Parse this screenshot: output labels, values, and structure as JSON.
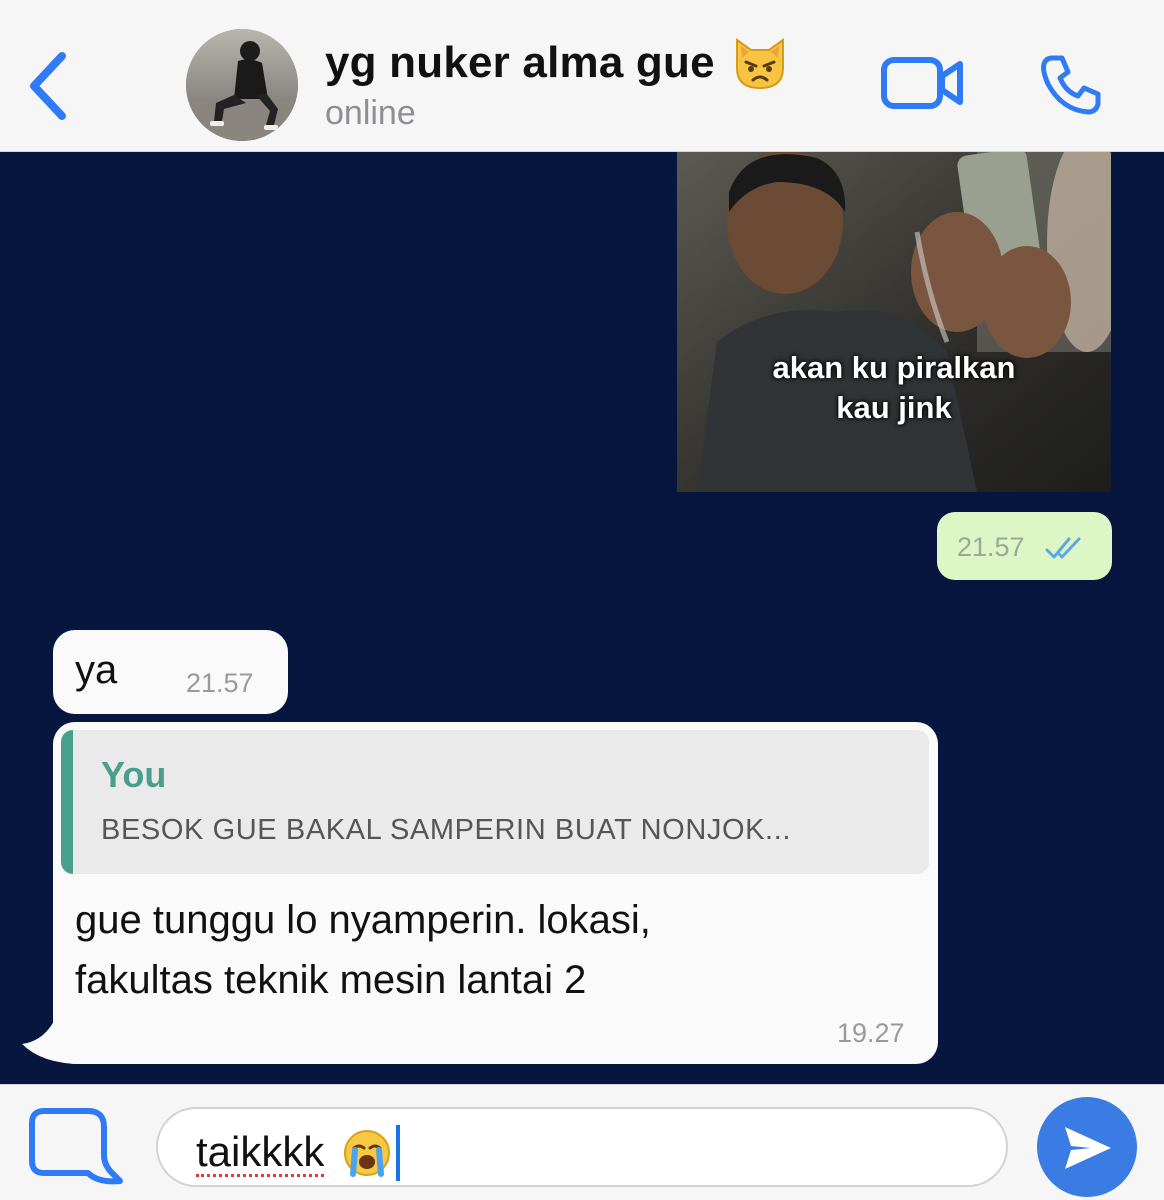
{
  "header": {
    "contact_name": "yg nuker alma gue",
    "status": "online",
    "accent_color": "#2f7bf5",
    "icons": [
      "chevron-left-icon",
      "avatar",
      "pouting-cat-emoji",
      "video-camera-icon",
      "phone-icon"
    ]
  },
  "messages": [
    {
      "direction": "outgoing",
      "type": "image",
      "caption_lines": [
        "akan ku piralkan",
        "kau jink"
      ],
      "time": "21.57",
      "read_receipt": "double-check-icon"
    },
    {
      "direction": "incoming",
      "type": "text",
      "text": "ya",
      "time": "21.57"
    },
    {
      "direction": "incoming",
      "type": "reply",
      "quoted_name": "You",
      "quoted_text": "BESOK GUE BAKAL SAMPERIN BUAT NONJOK...",
      "text_lines": [
        "gue tunggu lo nyamperin. lokasi,",
        "fakultas teknik mesin lantai 2"
      ],
      "time": "19.27"
    }
  ],
  "composer": {
    "input_value": "taikkkk",
    "input_emoji": "loudly-crying-face-emoji",
    "icons": [
      "sticker-icon",
      "send-icon"
    ]
  },
  "colors": {
    "chat_background": "#06163f",
    "outgoing_bubble": "#dcf7c5",
    "incoming_bubble": "#fafafa",
    "quote_accent": "#4a9e8c",
    "send_button": "#3a7be4"
  }
}
